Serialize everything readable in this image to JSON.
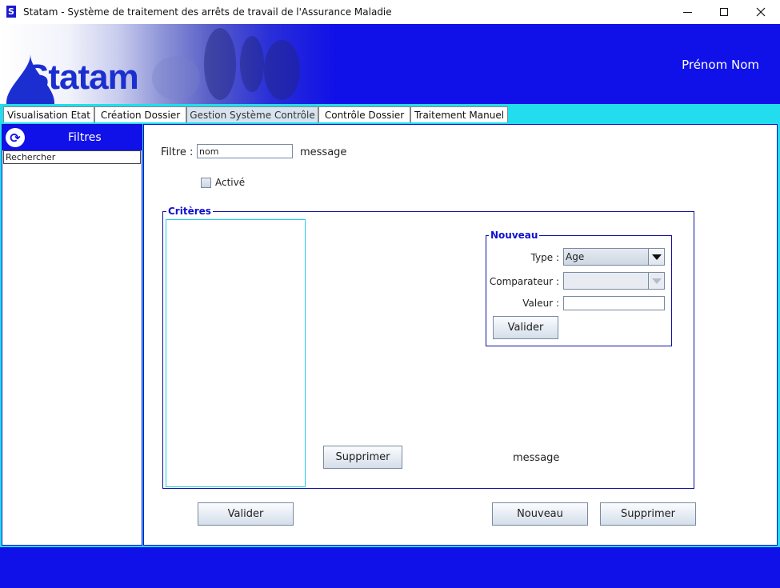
{
  "window": {
    "title": "Statam - Système de traitement des arrêts de travail de l'Assurance Maladie",
    "app_icon_letter": "S"
  },
  "banner": {
    "logo_text": "Statam",
    "user_name": "Prénom Nom"
  },
  "tabs": [
    {
      "label": "Visualisation Etat",
      "active": false
    },
    {
      "label": "Création Dossier",
      "active": false
    },
    {
      "label": "Gestion Système Contrôle",
      "active": true
    },
    {
      "label": "Contrôle Dossier",
      "active": false
    },
    {
      "label": "Traitement Manuel",
      "active": false
    }
  ],
  "sidebar": {
    "title": "Filtres",
    "search_value": "Rechercher"
  },
  "form": {
    "filter_label": "Filtre :",
    "filter_value": "nom",
    "filter_message": "message",
    "active_label": "Activé",
    "active_checked": false
  },
  "criteres": {
    "title": "Critères",
    "delete_button": "Supprimer",
    "message": "message"
  },
  "nouveau": {
    "title": "Nouveau",
    "type_label": "Type :",
    "type_value": "Age",
    "comparator_label": "Comparateur :",
    "comparator_value": "",
    "value_label": "Valeur :",
    "value_value": "",
    "validate_button": "Valider"
  },
  "actions": {
    "validate": "Valider",
    "new": "Nouveau",
    "delete": "Supprimer"
  },
  "colors": {
    "brand_blue": "#1010e8",
    "accent_cyan": "#22ddee"
  }
}
